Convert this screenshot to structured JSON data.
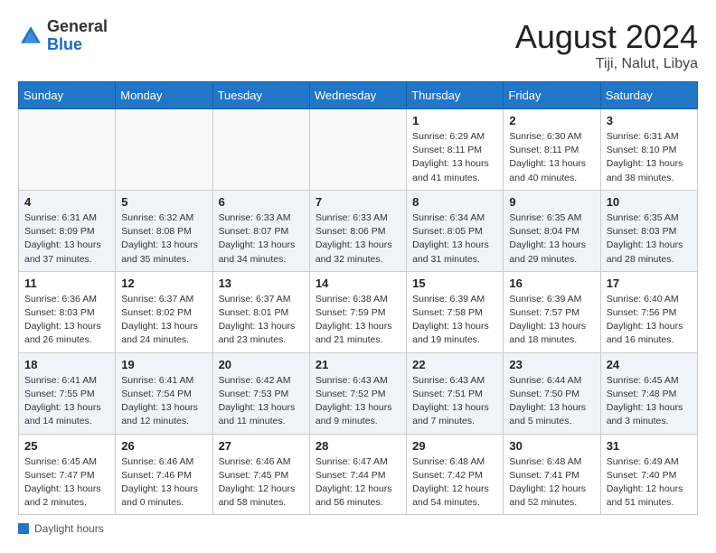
{
  "header": {
    "logo_line1": "General",
    "logo_line2": "Blue",
    "month_year": "August 2024",
    "location": "Tiji, Nalut, Libya"
  },
  "weekdays": [
    "Sunday",
    "Monday",
    "Tuesday",
    "Wednesday",
    "Thursday",
    "Friday",
    "Saturday"
  ],
  "weeks": [
    [
      {
        "day": "",
        "info": ""
      },
      {
        "day": "",
        "info": ""
      },
      {
        "day": "",
        "info": ""
      },
      {
        "day": "",
        "info": ""
      },
      {
        "day": "1",
        "info": "Sunrise: 6:29 AM\nSunset: 8:11 PM\nDaylight: 13 hours\nand 41 minutes."
      },
      {
        "day": "2",
        "info": "Sunrise: 6:30 AM\nSunset: 8:11 PM\nDaylight: 13 hours\nand 40 minutes."
      },
      {
        "day": "3",
        "info": "Sunrise: 6:31 AM\nSunset: 8:10 PM\nDaylight: 13 hours\nand 38 minutes."
      }
    ],
    [
      {
        "day": "4",
        "info": "Sunrise: 6:31 AM\nSunset: 8:09 PM\nDaylight: 13 hours\nand 37 minutes."
      },
      {
        "day": "5",
        "info": "Sunrise: 6:32 AM\nSunset: 8:08 PM\nDaylight: 13 hours\nand 35 minutes."
      },
      {
        "day": "6",
        "info": "Sunrise: 6:33 AM\nSunset: 8:07 PM\nDaylight: 13 hours\nand 34 minutes."
      },
      {
        "day": "7",
        "info": "Sunrise: 6:33 AM\nSunset: 8:06 PM\nDaylight: 13 hours\nand 32 minutes."
      },
      {
        "day": "8",
        "info": "Sunrise: 6:34 AM\nSunset: 8:05 PM\nDaylight: 13 hours\nand 31 minutes."
      },
      {
        "day": "9",
        "info": "Sunrise: 6:35 AM\nSunset: 8:04 PM\nDaylight: 13 hours\nand 29 minutes."
      },
      {
        "day": "10",
        "info": "Sunrise: 6:35 AM\nSunset: 8:03 PM\nDaylight: 13 hours\nand 28 minutes."
      }
    ],
    [
      {
        "day": "11",
        "info": "Sunrise: 6:36 AM\nSunset: 8:03 PM\nDaylight: 13 hours\nand 26 minutes."
      },
      {
        "day": "12",
        "info": "Sunrise: 6:37 AM\nSunset: 8:02 PM\nDaylight: 13 hours\nand 24 minutes."
      },
      {
        "day": "13",
        "info": "Sunrise: 6:37 AM\nSunset: 8:01 PM\nDaylight: 13 hours\nand 23 minutes."
      },
      {
        "day": "14",
        "info": "Sunrise: 6:38 AM\nSunset: 7:59 PM\nDaylight: 13 hours\nand 21 minutes."
      },
      {
        "day": "15",
        "info": "Sunrise: 6:39 AM\nSunset: 7:58 PM\nDaylight: 13 hours\nand 19 minutes."
      },
      {
        "day": "16",
        "info": "Sunrise: 6:39 AM\nSunset: 7:57 PM\nDaylight: 13 hours\nand 18 minutes."
      },
      {
        "day": "17",
        "info": "Sunrise: 6:40 AM\nSunset: 7:56 PM\nDaylight: 13 hours\nand 16 minutes."
      }
    ],
    [
      {
        "day": "18",
        "info": "Sunrise: 6:41 AM\nSunset: 7:55 PM\nDaylight: 13 hours\nand 14 minutes."
      },
      {
        "day": "19",
        "info": "Sunrise: 6:41 AM\nSunset: 7:54 PM\nDaylight: 13 hours\nand 12 minutes."
      },
      {
        "day": "20",
        "info": "Sunrise: 6:42 AM\nSunset: 7:53 PM\nDaylight: 13 hours\nand 11 minutes."
      },
      {
        "day": "21",
        "info": "Sunrise: 6:43 AM\nSunset: 7:52 PM\nDaylight: 13 hours\nand 9 minutes."
      },
      {
        "day": "22",
        "info": "Sunrise: 6:43 AM\nSunset: 7:51 PM\nDaylight: 13 hours\nand 7 minutes."
      },
      {
        "day": "23",
        "info": "Sunrise: 6:44 AM\nSunset: 7:50 PM\nDaylight: 13 hours\nand 5 minutes."
      },
      {
        "day": "24",
        "info": "Sunrise: 6:45 AM\nSunset: 7:48 PM\nDaylight: 13 hours\nand 3 minutes."
      }
    ],
    [
      {
        "day": "25",
        "info": "Sunrise: 6:45 AM\nSunset: 7:47 PM\nDaylight: 13 hours\nand 2 minutes."
      },
      {
        "day": "26",
        "info": "Sunrise: 6:46 AM\nSunset: 7:46 PM\nDaylight: 13 hours\nand 0 minutes."
      },
      {
        "day": "27",
        "info": "Sunrise: 6:46 AM\nSunset: 7:45 PM\nDaylight: 12 hours\nand 58 minutes."
      },
      {
        "day": "28",
        "info": "Sunrise: 6:47 AM\nSunset: 7:44 PM\nDaylight: 12 hours\nand 56 minutes."
      },
      {
        "day": "29",
        "info": "Sunrise: 6:48 AM\nSunset: 7:42 PM\nDaylight: 12 hours\nand 54 minutes."
      },
      {
        "day": "30",
        "info": "Sunrise: 6:48 AM\nSunset: 7:41 PM\nDaylight: 12 hours\nand 52 minutes."
      },
      {
        "day": "31",
        "info": "Sunrise: 6:49 AM\nSunset: 7:40 PM\nDaylight: 12 hours\nand 51 minutes."
      }
    ]
  ],
  "footer": {
    "label": "Daylight hours"
  }
}
